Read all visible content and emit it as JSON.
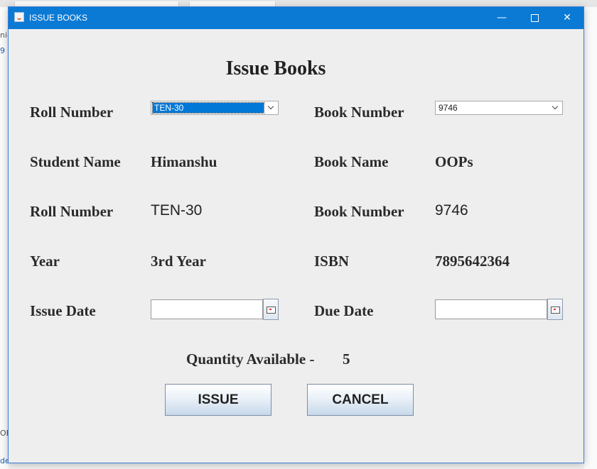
{
  "background": {
    "left_snippets": [
      "ni-",
      "9",
      "OB",
      "de"
    ]
  },
  "window": {
    "title": "ISSUE BOOKS",
    "controls": {
      "minimize": "—",
      "close": "✕"
    }
  },
  "form": {
    "heading": "Issue Books",
    "left": {
      "roll_number_label": "Roll Number",
      "roll_number_combo": "TEN-30",
      "student_name_label": "Student Name",
      "student_name_value": "Himanshu",
      "roll_number_label_2": "Roll Number",
      "roll_number_value": "TEN-30",
      "year_label": "Year",
      "year_value": "3rd Year",
      "issue_date_label": "Issue Date",
      "issue_date_value": ""
    },
    "right": {
      "book_number_label": "Book Number",
      "book_number_combo": "9746",
      "book_name_label": "Book Name",
      "book_name_value": "OOPs",
      "book_number_label_2": "Book Number",
      "book_number_value": "9746",
      "isbn_label": "ISBN",
      "isbn_value": "7895642364",
      "due_date_label": "Due Date",
      "due_date_value": ""
    },
    "quantity_label": "Quantity Available -",
    "quantity_value": "5",
    "issue_button": "ISSUE",
    "cancel_button": "CANCEL"
  },
  "colors": {
    "titlebar": "#0b7ad4",
    "window_bg": "#eeeeee",
    "selection": "#0078d7"
  }
}
